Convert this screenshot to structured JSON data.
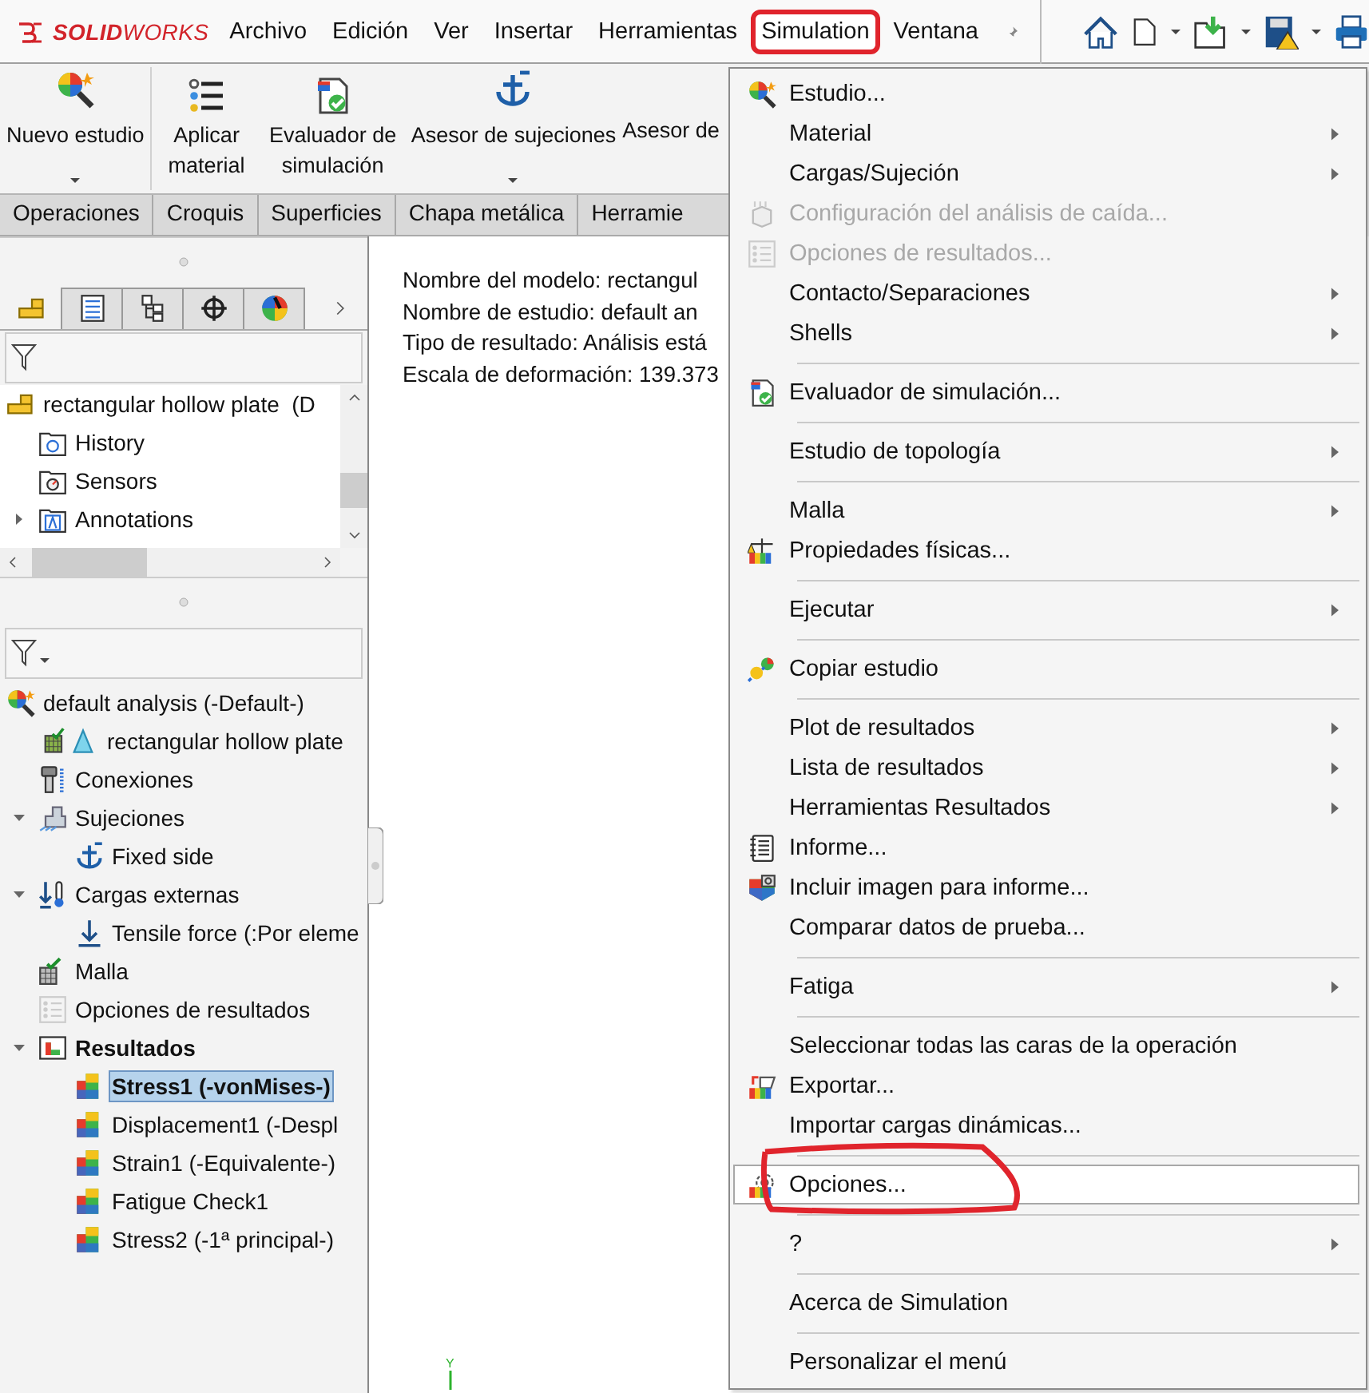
{
  "logo": "**SOLID**WORKS",
  "menu_bar": [
    {
      "label": "Archivo",
      "selected": false
    },
    {
      "label": "Edición",
      "selected": false
    },
    {
      "label": "Ver",
      "selected": false
    },
    {
      "label": "Insertar",
      "selected": false
    },
    {
      "label": "Herramientas",
      "selected": false
    },
    {
      "label": "Simulation",
      "selected": true,
      "annotated": true
    },
    {
      "label": "Ventana",
      "selected": false
    }
  ],
  "ribbon": {
    "groups": [
      {
        "buttons": [
          {
            "label": "Nuevo estudio",
            "kind": "study",
            "dropdown": true
          }
        ]
      },
      {
        "buttons": [
          {
            "label": "Aplicar material",
            "kind": "material",
            "dropdown": false
          },
          {
            "label": "Evaluador de simulación",
            "kind": "evaluator",
            "dropdown": false
          },
          {
            "label": "Asesor de sujeciones",
            "kind": "fixture",
            "dropdown": true
          },
          {
            "label": "Asesor de",
            "kind": "plain",
            "dropdown": false
          }
        ]
      }
    ]
  },
  "tabs": [
    {
      "label": "Operaciones"
    },
    {
      "label": "Croquis"
    },
    {
      "label": "Superficies"
    },
    {
      "label": "Chapa metálica"
    },
    {
      "label": "Herramie"
    }
  ],
  "panel_tabs": [
    {
      "kind": "part",
      "selected": true
    },
    {
      "kind": "property",
      "selected": false
    },
    {
      "kind": "config",
      "selected": false
    },
    {
      "kind": "target",
      "selected": false
    },
    {
      "kind": "appearance",
      "selected": false
    }
  ],
  "feature_tree": [
    {
      "label": "rectangular hollow plate  (D",
      "kind": "part",
      "children": [
        {
          "label": "History",
          "kind": "history"
        },
        {
          "label": "Sensors",
          "kind": "sensors"
        },
        {
          "label": "Annotations",
          "kind": "annotations",
          "expanded": false
        }
      ]
    }
  ],
  "simulation_tree": [
    {
      "label": "default analysis (-Default-)",
      "kind": "study",
      "children": [
        {
          "label": "rectangular hollow plate",
          "kind": "solid"
        },
        {
          "label": "Conexiones",
          "kind": "connections"
        },
        {
          "label": "Sujeciones",
          "kind": "fixtures",
          "expanded": true,
          "children": [
            {
              "label": "Fixed side",
              "kind": "fixture"
            }
          ]
        },
        {
          "label": "Cargas externas",
          "kind": "loads",
          "expanded": true,
          "children": [
            {
              "label": "Tensile force (:Por eleme",
              "kind": "load"
            }
          ]
        },
        {
          "label": "Malla",
          "kind": "mesh"
        },
        {
          "label": "Opciones de resultados",
          "kind": "options"
        },
        {
          "label": "Resultados",
          "kind": "results",
          "expanded": true,
          "active": true,
          "children": [
            {
              "label": "Stress1 (-vonMises-)",
              "kind": "plot",
              "selected": true,
              "active": true
            },
            {
              "label": "Displacement1 (-Despl",
              "kind": "plot",
              "selected": false,
              "active": false
            },
            {
              "label": "Strain1 (-Equivalente-)",
              "kind": "plot",
              "selected": false,
              "active": false
            },
            {
              "label": "Fatigue Check1",
              "kind": "plot",
              "selected": false,
              "active": false
            },
            {
              "label": "Stress2 (-1ª principal-)",
              "kind": "plot",
              "selected": false,
              "active": false
            }
          ]
        }
      ]
    }
  ],
  "graphics": {
    "lines": [
      "Nombre del modelo: rectangul",
      "Nombre de estudio: default an",
      "Tipo de resultado: Análisis está",
      "Escala de deformación: 139.373"
    ],
    "axis_label": "Y"
  },
  "menu": [
    {
      "kind": "study",
      "label": "Estudio...",
      "submenu": false,
      "disabled": false,
      "selected": false
    },
    {
      "kind": "plain",
      "label": "Material",
      "submenu": true,
      "disabled": false,
      "selected": false
    },
    {
      "kind": "plain",
      "label": "Cargas/Sujeción",
      "submenu": true,
      "disabled": false,
      "selected": false
    },
    {
      "kind": "drop",
      "label": "Configuración del análisis de caída...",
      "submenu": false,
      "disabled": true,
      "selected": false
    },
    {
      "kind": "options",
      "label": "Opciones de resultados...",
      "submenu": false,
      "disabled": true,
      "selected": false
    },
    {
      "kind": "plain",
      "label": "Contacto/Separaciones",
      "submenu": true,
      "disabled": false,
      "selected": false
    },
    {
      "kind": "plain",
      "label": "Shells",
      "submenu": true,
      "disabled": false,
      "selected": false
    },
    {
      "kind": "separator"
    },
    {
      "kind": "evaluator",
      "label": "Evaluador de simulación...",
      "submenu": false,
      "disabled": false,
      "selected": false
    },
    {
      "kind": "separator"
    },
    {
      "kind": "plain",
      "label": "Estudio de topología",
      "submenu": true,
      "disabled": false,
      "selected": false
    },
    {
      "kind": "separator"
    },
    {
      "kind": "plain",
      "label": "Malla",
      "submenu": true,
      "disabled": false,
      "selected": false
    },
    {
      "kind": "mass",
      "label": "Propiedades físicas...",
      "submenu": false,
      "disabled": false,
      "selected": false
    },
    {
      "kind": "separator"
    },
    {
      "kind": "plain",
      "label": "Ejecutar",
      "submenu": true,
      "disabled": false,
      "selected": false
    },
    {
      "kind": "separator"
    },
    {
      "kind": "copy",
      "label": "Copiar estudio",
      "submenu": false,
      "disabled": false,
      "selected": false
    },
    {
      "kind": "separator"
    },
    {
      "kind": "plain",
      "label": "Plot de resultados",
      "submenu": true,
      "disabled": false,
      "selected": false
    },
    {
      "kind": "plain",
      "label": "Lista de resultados",
      "submenu": true,
      "disabled": false,
      "selected": false
    },
    {
      "kind": "plain",
      "label": "Herramientas Resultados",
      "submenu": true,
      "disabled": false,
      "selected": false
    },
    {
      "kind": "report",
      "label": "Informe...",
      "submenu": false,
      "disabled": false,
      "selected": false
    },
    {
      "kind": "image",
      "label": "Incluir imagen para informe...",
      "submenu": false,
      "disabled": false,
      "selected": false
    },
    {
      "kind": "plain",
      "label": "Comparar datos de prueba...",
      "submenu": false,
      "disabled": false,
      "selected": false
    },
    {
      "kind": "separator"
    },
    {
      "kind": "plain",
      "label": "Fatiga",
      "submenu": true,
      "disabled": false,
      "selected": false
    },
    {
      "kind": "separator"
    },
    {
      "kind": "plain",
      "label": "Seleccionar todas las caras de la operación",
      "submenu": false,
      "disabled": false,
      "selected": false
    },
    {
      "kind": "export",
      "label": "Exportar...",
      "submenu": false,
      "disabled": false,
      "selected": false
    },
    {
      "kind": "plain",
      "label": "Importar cargas dinámicas...",
      "submenu": false,
      "disabled": false,
      "selected": false
    },
    {
      "kind": "separator"
    },
    {
      "kind": "gear",
      "label": "Opciones...",
      "submenu": false,
      "disabled": false,
      "selected": true,
      "annotated": true
    },
    {
      "kind": "separator"
    },
    {
      "kind": "plain",
      "label": "?",
      "submenu": true,
      "disabled": false,
      "selected": false
    },
    {
      "kind": "separator"
    },
    {
      "kind": "plain",
      "label": "Acerca de Simulation",
      "submenu": false,
      "disabled": false,
      "selected": false
    },
    {
      "kind": "separator"
    },
    {
      "kind": "plain",
      "label": "Personalizar el menú",
      "submenu": false,
      "disabled": false,
      "selected": false
    }
  ]
}
